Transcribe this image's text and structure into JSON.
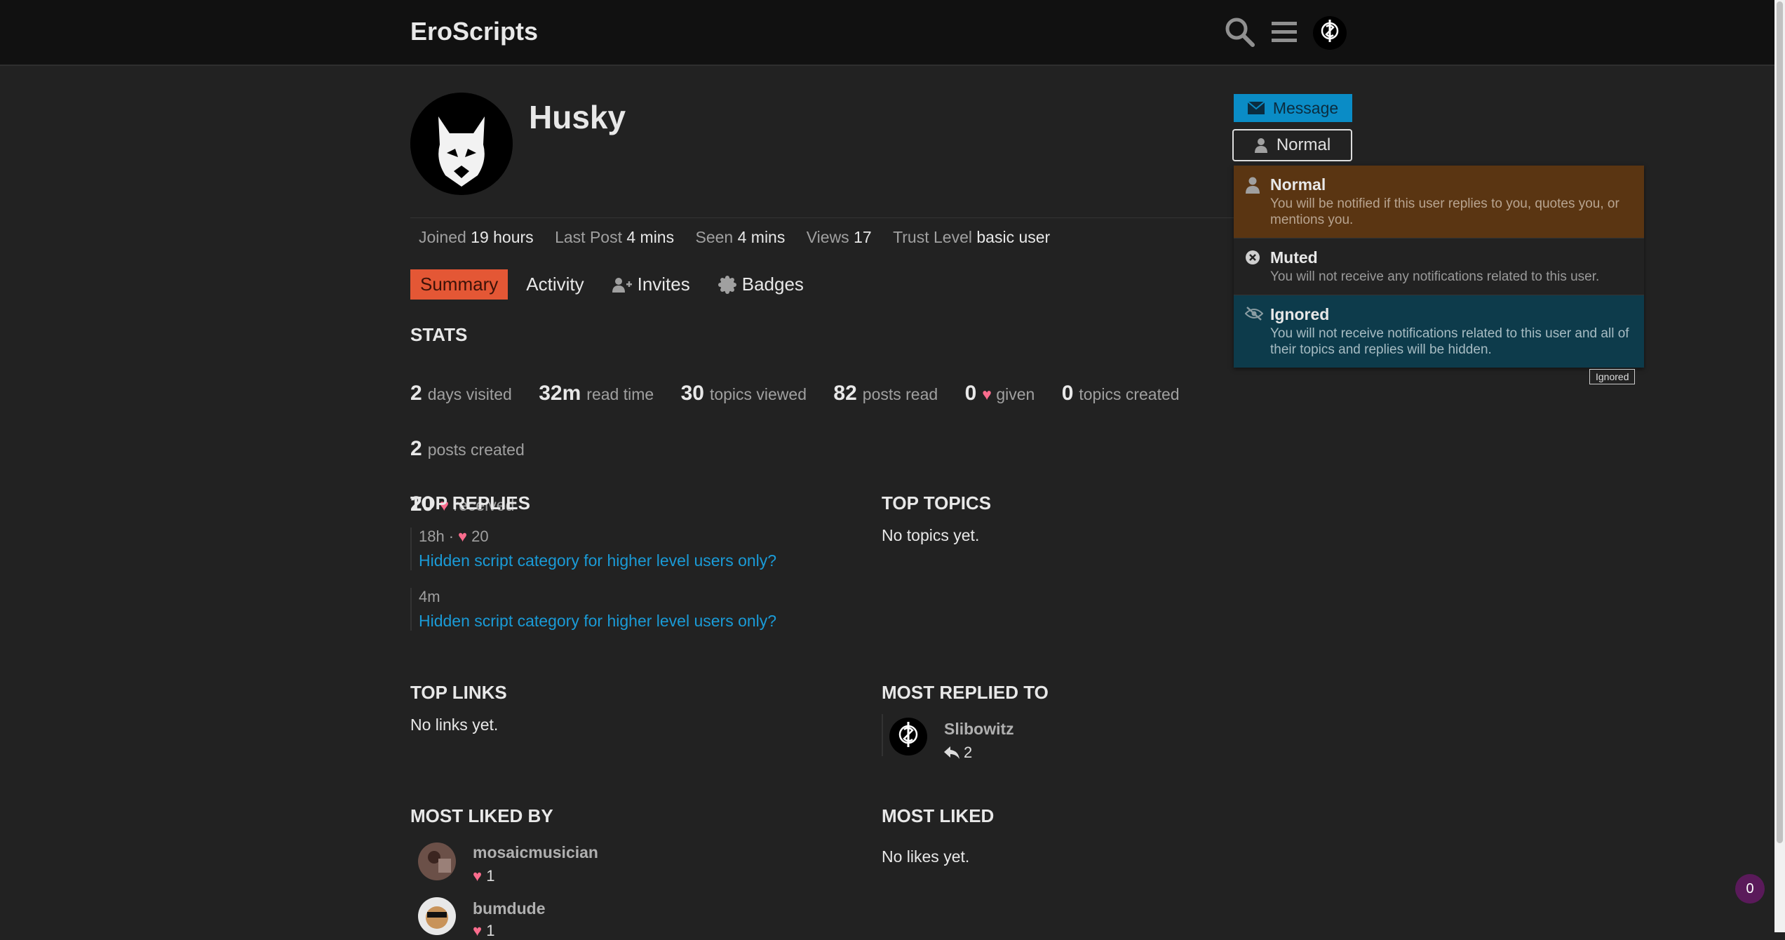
{
  "header": {
    "site_title": "EroScripts"
  },
  "profile": {
    "username": "Husky"
  },
  "actions": {
    "message_label": "Message",
    "notification_label": "Normal"
  },
  "meta": {
    "joined_label": "Joined",
    "joined_value": "19 hours",
    "last_post_label": "Last Post",
    "last_post_value": "4 mins",
    "seen_label": "Seen",
    "seen_value": "4 mins",
    "views_label": "Views",
    "views_value": "17",
    "trust_label": "Trust Level",
    "trust_value": "basic user"
  },
  "tabs": [
    {
      "label": "Summary"
    },
    {
      "label": "Activity"
    },
    {
      "label": "Invites"
    },
    {
      "label": "Badges"
    }
  ],
  "stats": {
    "title": "STATS",
    "items": [
      {
        "value": "2",
        "label": "days visited"
      },
      {
        "value": "32m",
        "label": "read time"
      },
      {
        "value": "30",
        "label": "topics viewed"
      },
      {
        "value": "82",
        "label": "posts read"
      },
      {
        "value": "0",
        "label": "given"
      },
      {
        "value": "0",
        "label": "topics created"
      },
      {
        "value": "2",
        "label": "posts created"
      },
      {
        "value": "20",
        "label": "received"
      }
    ]
  },
  "top_replies": {
    "title": "TOP REPLIES",
    "items": [
      {
        "age": "18h",
        "sep": "·",
        "likes": "20",
        "link": "Hidden script category for higher level users only?"
      },
      {
        "age": "4m",
        "link": "Hidden script category for higher level users only?"
      }
    ]
  },
  "top_topics": {
    "title": "TOP TOPICS",
    "empty": "No topics yet."
  },
  "top_links": {
    "title": "TOP LINKS",
    "empty": "No links yet."
  },
  "most_replied_to": {
    "title": "MOST REPLIED TO",
    "user": "Slibowitz",
    "count": "2"
  },
  "most_liked_by": {
    "title": "MOST LIKED BY",
    "users": [
      {
        "name": "mosaicmusician",
        "count": "1"
      },
      {
        "name": "bumdude",
        "count": "1"
      }
    ]
  },
  "most_liked": {
    "title": "MOST LIKED",
    "empty": "No likes yet."
  },
  "dropdown": {
    "items": [
      {
        "title": "Normal",
        "desc": "You will be notified if this user replies to you, quotes you, or mentions you."
      },
      {
        "title": "Muted",
        "desc": "You will not receive any notifications related to this user."
      },
      {
        "title": "Ignored",
        "desc": "You will not receive notifications related to this user and all of their topics and replies will be hidden."
      }
    ],
    "tooltip": "Ignored"
  },
  "floating_badge": "0",
  "colors": {
    "accent": "#e45735",
    "link": "#1a9bd7",
    "heart": "#fa6c8d",
    "primary_button": "#0a8cc6"
  }
}
